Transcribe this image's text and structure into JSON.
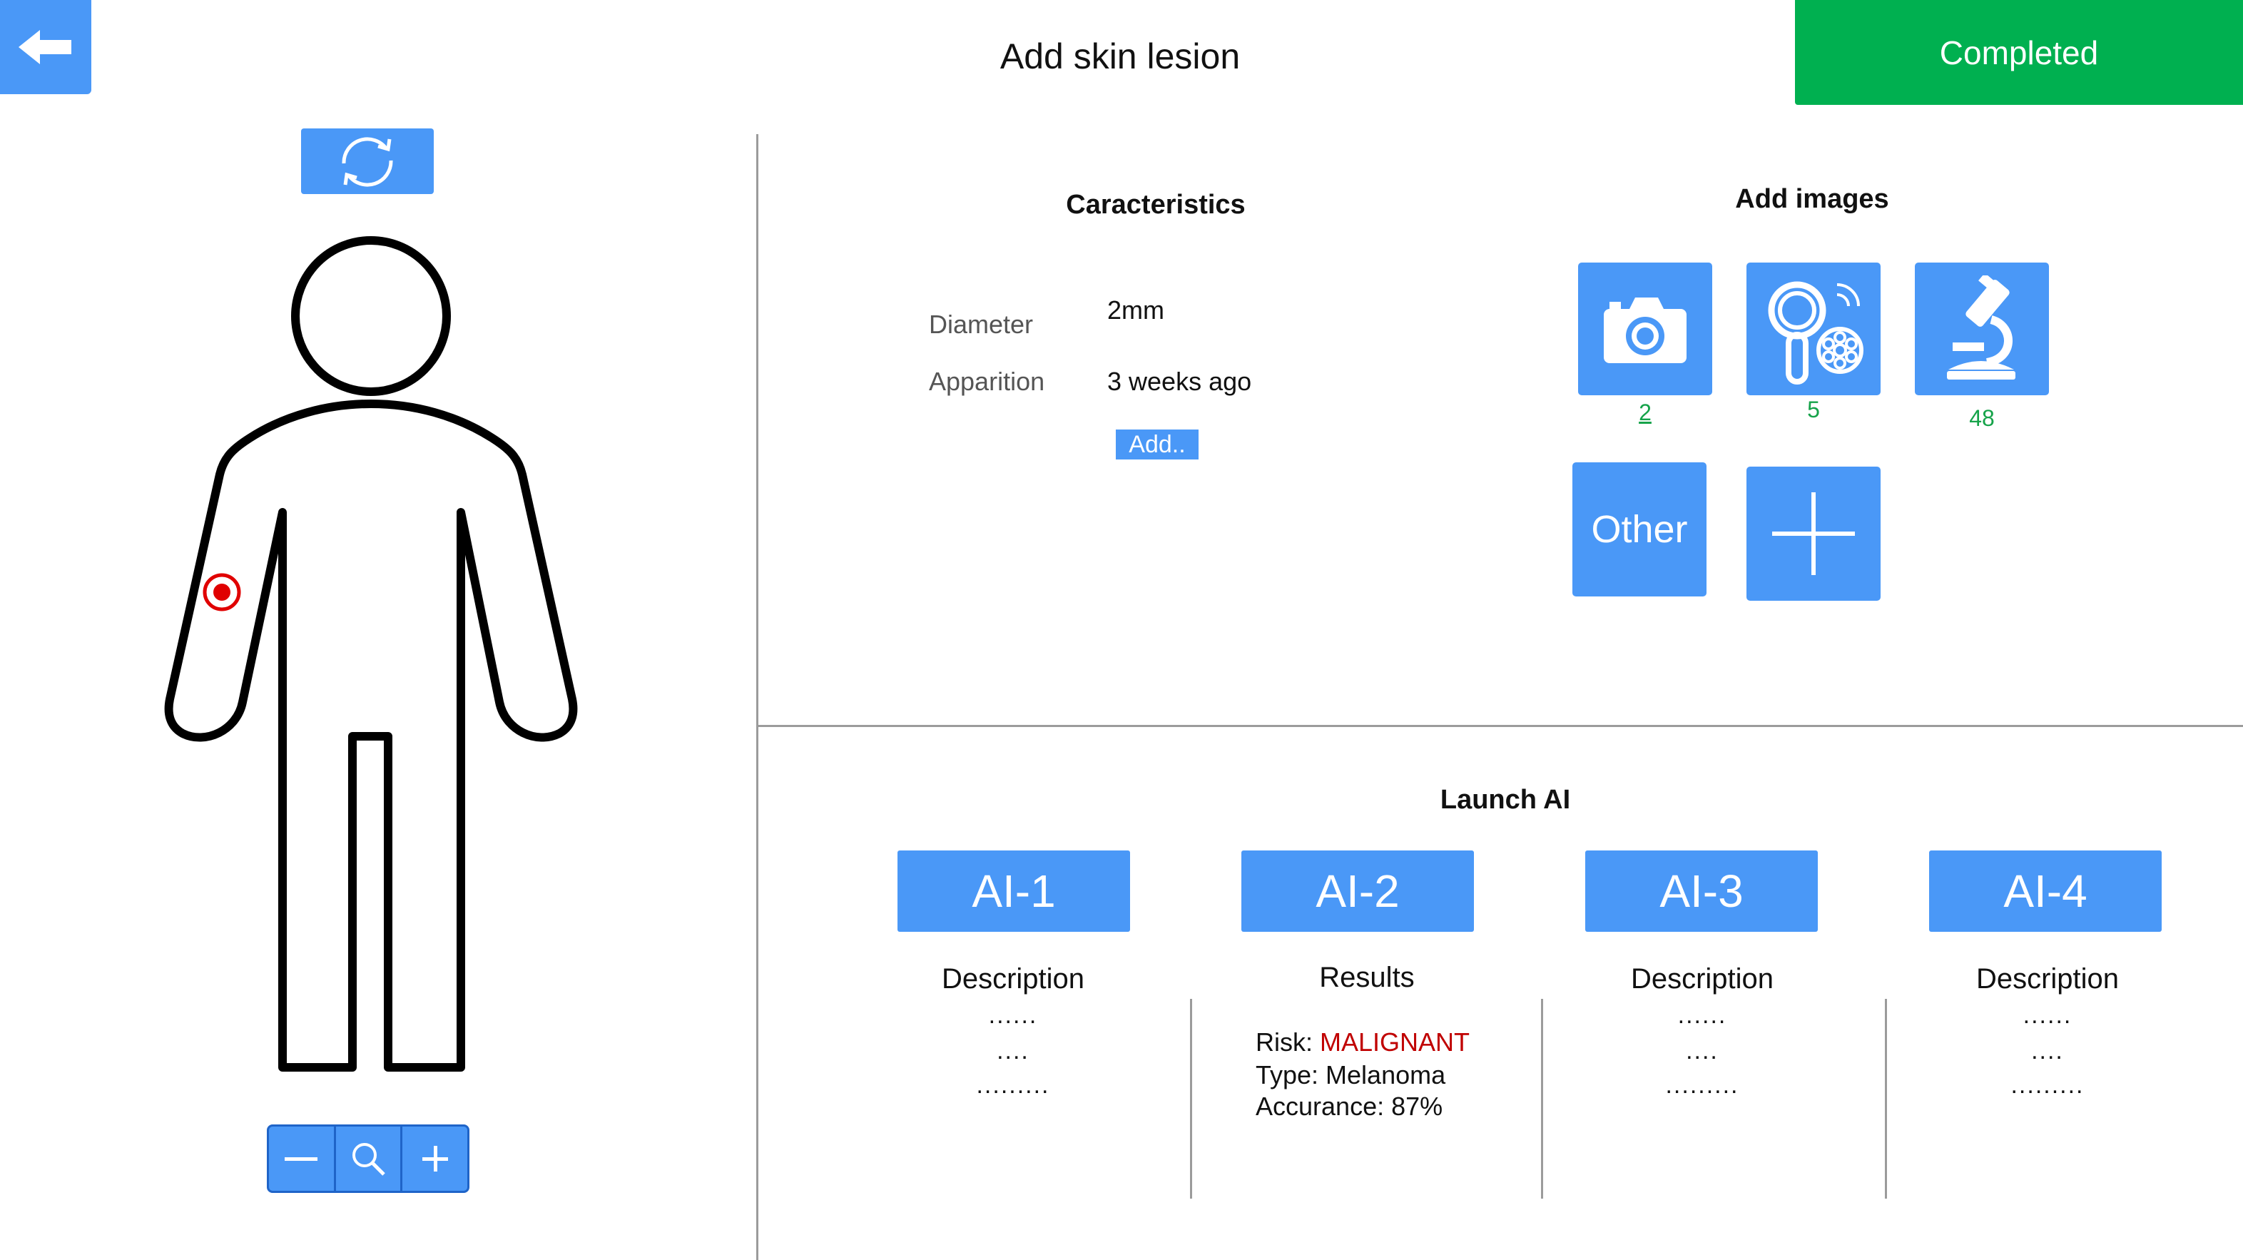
{
  "header": {
    "title": "Add skin lesion",
    "completed_label": "Completed"
  },
  "characteristics": {
    "heading": "Caracteristics",
    "rows": [
      {
        "label": "Diameter",
        "value": "2mm"
      },
      {
        "label": "Apparition",
        "value": "3 weeks ago"
      }
    ],
    "add_label": "Add.."
  },
  "images": {
    "heading": "Add images",
    "tiles": [
      {
        "icon": "camera-icon",
        "count": "2"
      },
      {
        "icon": "dermatoscope-icon",
        "count": "5"
      },
      {
        "icon": "microscope-icon",
        "count": "48"
      }
    ],
    "other_label": "Other"
  },
  "ai": {
    "heading": "Launch AI",
    "models": [
      {
        "label": "AI-1",
        "heading": "Description",
        "lines": [
          "......",
          "....",
          "........."
        ]
      },
      {
        "label": "AI-2",
        "heading": "Results",
        "risk_label": "Risk:",
        "risk_value": "MALIGNANT",
        "type_line": "Type: Melanoma",
        "accuracy_line": "Accurance: 87%"
      },
      {
        "label": "AI-3",
        "heading": "Description",
        "lines": [
          "......",
          "....",
          "........."
        ]
      },
      {
        "label": "AI-4",
        "heading": "Description",
        "lines": [
          "......",
          "....",
          "........."
        ]
      }
    ]
  },
  "colors": {
    "accent_blue": "#4a98f7",
    "completed_green": "#00b050",
    "risk_red": "#c00000",
    "count_green": "#16a34a",
    "lesion_marker": "#e00000"
  }
}
